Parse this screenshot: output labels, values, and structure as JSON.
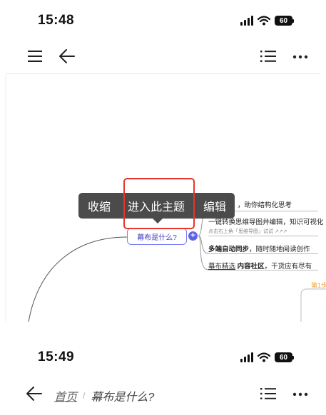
{
  "screen1": {
    "status_bar": {
      "time": "15:48",
      "battery": "60"
    },
    "mindmap": {
      "texts": {
        "t1": "，助你结构化思考",
        "t2": "一键转换思维导图并编辑，知识可视化",
        "t3": "点击右上角「思维导图」试试 ↗↗↗",
        "t4a": "多端自动同步",
        "t4b": "，随时随地阅读创作",
        "t5a": "幕布精选",
        "t5b": "内容社区",
        "t5c": "，干货应有尽有",
        "t6": "第1步"
      },
      "central_node": "幕布是什么?",
      "accent": "#5d62e6"
    },
    "context_menu": {
      "items": [
        "收缩",
        "进入此主题",
        "编辑"
      ],
      "highlight_color": "#e8342a"
    }
  },
  "screen2": {
    "status_bar": {
      "time": "15:49",
      "battery": "60"
    },
    "breadcrumb": {
      "home": "首页",
      "separator": "/",
      "current": "幕布是什么?"
    }
  }
}
